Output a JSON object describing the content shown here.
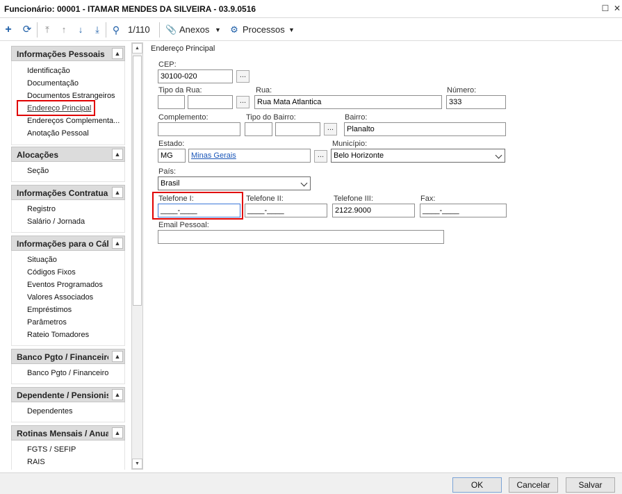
{
  "window": {
    "title": "Funcionário: 00001 - ITAMAR MENDES DA SILVEIRA - 03.9.0516"
  },
  "toolbar": {
    "record_counter": "1/110",
    "attachments_label": "Anexos",
    "processes_label": "Processos"
  },
  "sidebar": {
    "groups": [
      {
        "title": "Informações Pessoais",
        "items": [
          "Identificação",
          "Documentação",
          "Documentos Estrangeiros",
          "Endereço Principal",
          "Endereços Complementa...",
          "Anotação Pessoal"
        ]
      },
      {
        "title": "Alocações",
        "items": [
          "Seção"
        ]
      },
      {
        "title": "Informações Contratua",
        "items": [
          "Registro",
          "Salário / Jornada"
        ]
      },
      {
        "title": "Informações para o Cál",
        "items": [
          "Situação",
          "Códigos Fixos",
          "Eventos Programados",
          "Valores Associados",
          "Empréstimos",
          "Parâmetros",
          "Rateio Tomadores"
        ]
      },
      {
        "title": "Banco Pgto / Financeiro",
        "items": [
          "Banco Pgto / Financeiro"
        ]
      },
      {
        "title": "Dependente / Pensionis",
        "items": [
          "Dependentes"
        ]
      },
      {
        "title": "Rotinas Mensais / Anua",
        "items": [
          "FGTS / SEFIP",
          "RAIS"
        ]
      }
    ]
  },
  "form": {
    "section_title": "Endereço Principal",
    "cep": {
      "label": "CEP:",
      "value": "30100-020"
    },
    "tipo_rua": {
      "label": "Tipo da Rua:",
      "value": ""
    },
    "rua": {
      "label": "Rua:",
      "value": "Rua Mata Atlantica"
    },
    "numero": {
      "label": "Número:",
      "value": "333"
    },
    "complemento": {
      "label": "Complemento:",
      "value": ""
    },
    "tipo_bairro": {
      "label": "Tipo do Bairro:",
      "value": ""
    },
    "bairro": {
      "label": "Bairro:",
      "value": "Planalto"
    },
    "estado": {
      "label": "Estado:",
      "code": "MG",
      "name": "Minas Gerais"
    },
    "municipio": {
      "label": "Município:",
      "value": "Belo Horizonte"
    },
    "pais": {
      "label": "País:",
      "value": "Brasil"
    },
    "telefone1": {
      "label": "Telefone I:",
      "value": "____-____"
    },
    "telefone2": {
      "label": "Telefone II:",
      "value": "____-____"
    },
    "telefone3": {
      "label": "Telefone III:",
      "value": "2122.9000"
    },
    "fax": {
      "label": "Fax:",
      "value": "____-____"
    },
    "email": {
      "label": "Email Pessoal:",
      "value": ""
    },
    "dots_label": "..."
  },
  "footer": {
    "ok": "OK",
    "cancel": "Cancelar",
    "save": "Salvar"
  },
  "colors": {
    "highlight_box": "#e00000",
    "toolbar_icon": "#1f5fa8"
  }
}
